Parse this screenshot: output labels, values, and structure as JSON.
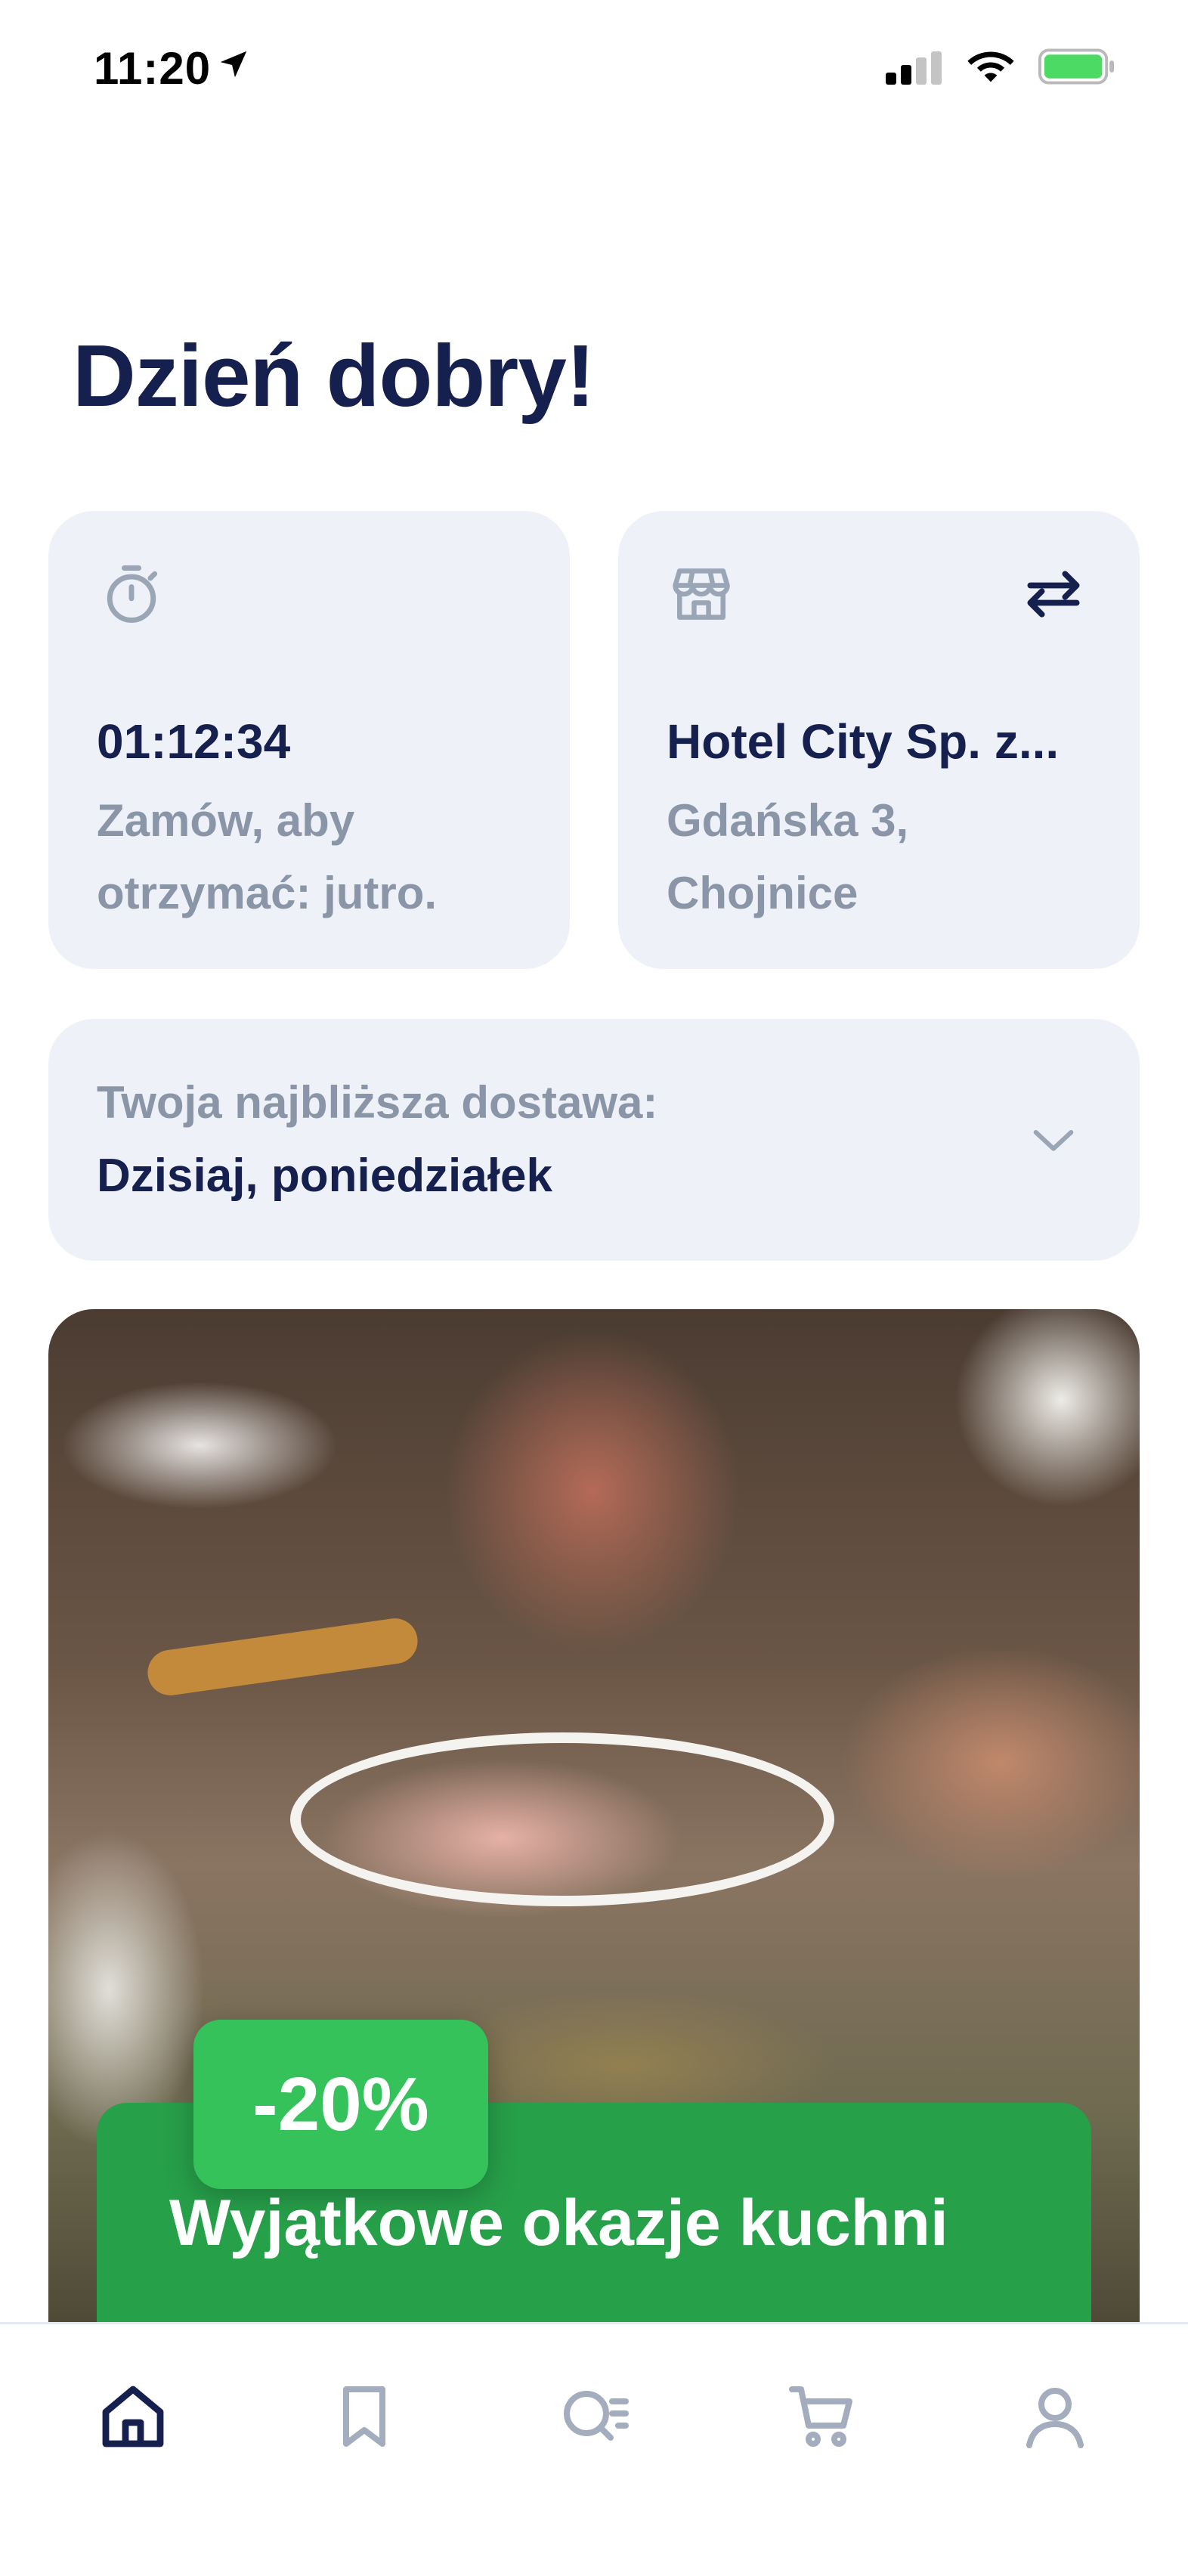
{
  "status_bar": {
    "time": "11:20",
    "location_icon": "location-arrow-icon",
    "signal_icon": "cellular-signal-icon",
    "wifi_icon": "wifi-icon",
    "battery_icon": "battery-icon"
  },
  "greeting": "Dzień dobry!",
  "timer_card": {
    "icon": "stopwatch-icon",
    "countdown": "01:12:34",
    "subtitle": "Zamów, aby otrzymać: jutro."
  },
  "store_card": {
    "icon": "store-icon",
    "switch_icon": "swap-arrows-icon",
    "name": "Hotel City Sp. z...",
    "address": "Gdańska 3, Chojnice"
  },
  "delivery_card": {
    "label": "Twoja najbliższa dostawa:",
    "value": "Dzisiaj, poniedziałek",
    "icon": "chevron-down-icon"
  },
  "promo": {
    "badge": "-20%",
    "title": "Wyjątkowe okazje kuchni"
  },
  "tab_bar": {
    "items": [
      {
        "name": "home",
        "icon": "home-icon",
        "active": true
      },
      {
        "name": "bookmarks",
        "icon": "bookmark-icon",
        "active": false
      },
      {
        "name": "search",
        "icon": "search-list-icon",
        "active": false
      },
      {
        "name": "cart",
        "icon": "cart-icon",
        "active": false
      },
      {
        "name": "profile",
        "icon": "user-icon",
        "active": false
      }
    ]
  },
  "colors": {
    "primary_text": "#16204f",
    "muted_text": "#8a96a8",
    "card_bg": "#eef2f8",
    "promo_green": "#27a04a",
    "badge_green": "#35c25a",
    "tab_inactive": "#a3adbd"
  }
}
